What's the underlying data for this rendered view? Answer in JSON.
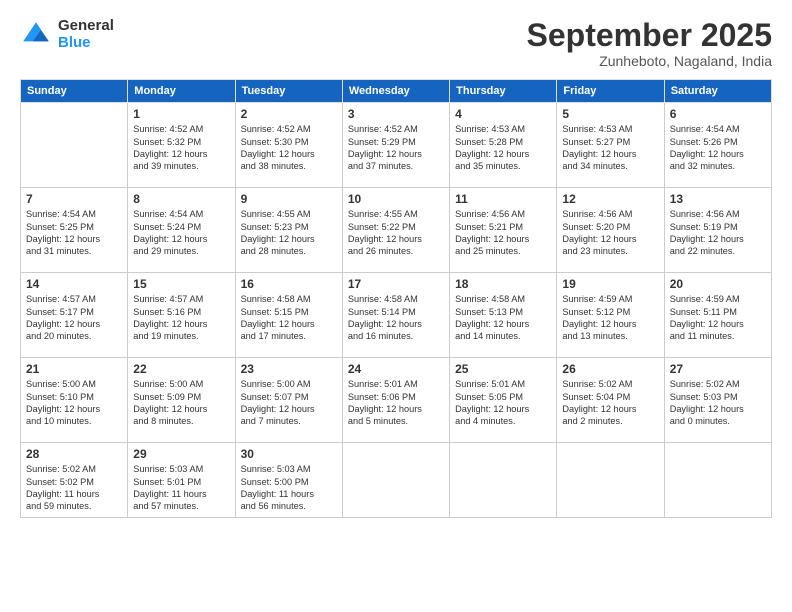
{
  "logo": {
    "general": "General",
    "blue": "Blue"
  },
  "header": {
    "month": "September 2025",
    "location": "Zunheboto, Nagaland, India"
  },
  "days": [
    "Sunday",
    "Monday",
    "Tuesday",
    "Wednesday",
    "Thursday",
    "Friday",
    "Saturday"
  ],
  "weeks": [
    [
      {
        "num": "",
        "info": ""
      },
      {
        "num": "1",
        "info": "Sunrise: 4:52 AM\nSunset: 5:32 PM\nDaylight: 12 hours\nand 39 minutes."
      },
      {
        "num": "2",
        "info": "Sunrise: 4:52 AM\nSunset: 5:30 PM\nDaylight: 12 hours\nand 38 minutes."
      },
      {
        "num": "3",
        "info": "Sunrise: 4:52 AM\nSunset: 5:29 PM\nDaylight: 12 hours\nand 37 minutes."
      },
      {
        "num": "4",
        "info": "Sunrise: 4:53 AM\nSunset: 5:28 PM\nDaylight: 12 hours\nand 35 minutes."
      },
      {
        "num": "5",
        "info": "Sunrise: 4:53 AM\nSunset: 5:27 PM\nDaylight: 12 hours\nand 34 minutes."
      },
      {
        "num": "6",
        "info": "Sunrise: 4:54 AM\nSunset: 5:26 PM\nDaylight: 12 hours\nand 32 minutes."
      }
    ],
    [
      {
        "num": "7",
        "info": "Sunrise: 4:54 AM\nSunset: 5:25 PM\nDaylight: 12 hours\nand 31 minutes."
      },
      {
        "num": "8",
        "info": "Sunrise: 4:54 AM\nSunset: 5:24 PM\nDaylight: 12 hours\nand 29 minutes."
      },
      {
        "num": "9",
        "info": "Sunrise: 4:55 AM\nSunset: 5:23 PM\nDaylight: 12 hours\nand 28 minutes."
      },
      {
        "num": "10",
        "info": "Sunrise: 4:55 AM\nSunset: 5:22 PM\nDaylight: 12 hours\nand 26 minutes."
      },
      {
        "num": "11",
        "info": "Sunrise: 4:56 AM\nSunset: 5:21 PM\nDaylight: 12 hours\nand 25 minutes."
      },
      {
        "num": "12",
        "info": "Sunrise: 4:56 AM\nSunset: 5:20 PM\nDaylight: 12 hours\nand 23 minutes."
      },
      {
        "num": "13",
        "info": "Sunrise: 4:56 AM\nSunset: 5:19 PM\nDaylight: 12 hours\nand 22 minutes."
      }
    ],
    [
      {
        "num": "14",
        "info": "Sunrise: 4:57 AM\nSunset: 5:17 PM\nDaylight: 12 hours\nand 20 minutes."
      },
      {
        "num": "15",
        "info": "Sunrise: 4:57 AM\nSunset: 5:16 PM\nDaylight: 12 hours\nand 19 minutes."
      },
      {
        "num": "16",
        "info": "Sunrise: 4:58 AM\nSunset: 5:15 PM\nDaylight: 12 hours\nand 17 minutes."
      },
      {
        "num": "17",
        "info": "Sunrise: 4:58 AM\nSunset: 5:14 PM\nDaylight: 12 hours\nand 16 minutes."
      },
      {
        "num": "18",
        "info": "Sunrise: 4:58 AM\nSunset: 5:13 PM\nDaylight: 12 hours\nand 14 minutes."
      },
      {
        "num": "19",
        "info": "Sunrise: 4:59 AM\nSunset: 5:12 PM\nDaylight: 12 hours\nand 13 minutes."
      },
      {
        "num": "20",
        "info": "Sunrise: 4:59 AM\nSunset: 5:11 PM\nDaylight: 12 hours\nand 11 minutes."
      }
    ],
    [
      {
        "num": "21",
        "info": "Sunrise: 5:00 AM\nSunset: 5:10 PM\nDaylight: 12 hours\nand 10 minutes."
      },
      {
        "num": "22",
        "info": "Sunrise: 5:00 AM\nSunset: 5:09 PM\nDaylight: 12 hours\nand 8 minutes."
      },
      {
        "num": "23",
        "info": "Sunrise: 5:00 AM\nSunset: 5:07 PM\nDaylight: 12 hours\nand 7 minutes."
      },
      {
        "num": "24",
        "info": "Sunrise: 5:01 AM\nSunset: 5:06 PM\nDaylight: 12 hours\nand 5 minutes."
      },
      {
        "num": "25",
        "info": "Sunrise: 5:01 AM\nSunset: 5:05 PM\nDaylight: 12 hours\nand 4 minutes."
      },
      {
        "num": "26",
        "info": "Sunrise: 5:02 AM\nSunset: 5:04 PM\nDaylight: 12 hours\nand 2 minutes."
      },
      {
        "num": "27",
        "info": "Sunrise: 5:02 AM\nSunset: 5:03 PM\nDaylight: 12 hours\nand 0 minutes."
      }
    ],
    [
      {
        "num": "28",
        "info": "Sunrise: 5:02 AM\nSunset: 5:02 PM\nDaylight: 11 hours\nand 59 minutes."
      },
      {
        "num": "29",
        "info": "Sunrise: 5:03 AM\nSunset: 5:01 PM\nDaylight: 11 hours\nand 57 minutes."
      },
      {
        "num": "30",
        "info": "Sunrise: 5:03 AM\nSunset: 5:00 PM\nDaylight: 11 hours\nand 56 minutes."
      },
      {
        "num": "",
        "info": ""
      },
      {
        "num": "",
        "info": ""
      },
      {
        "num": "",
        "info": ""
      },
      {
        "num": "",
        "info": ""
      }
    ]
  ]
}
